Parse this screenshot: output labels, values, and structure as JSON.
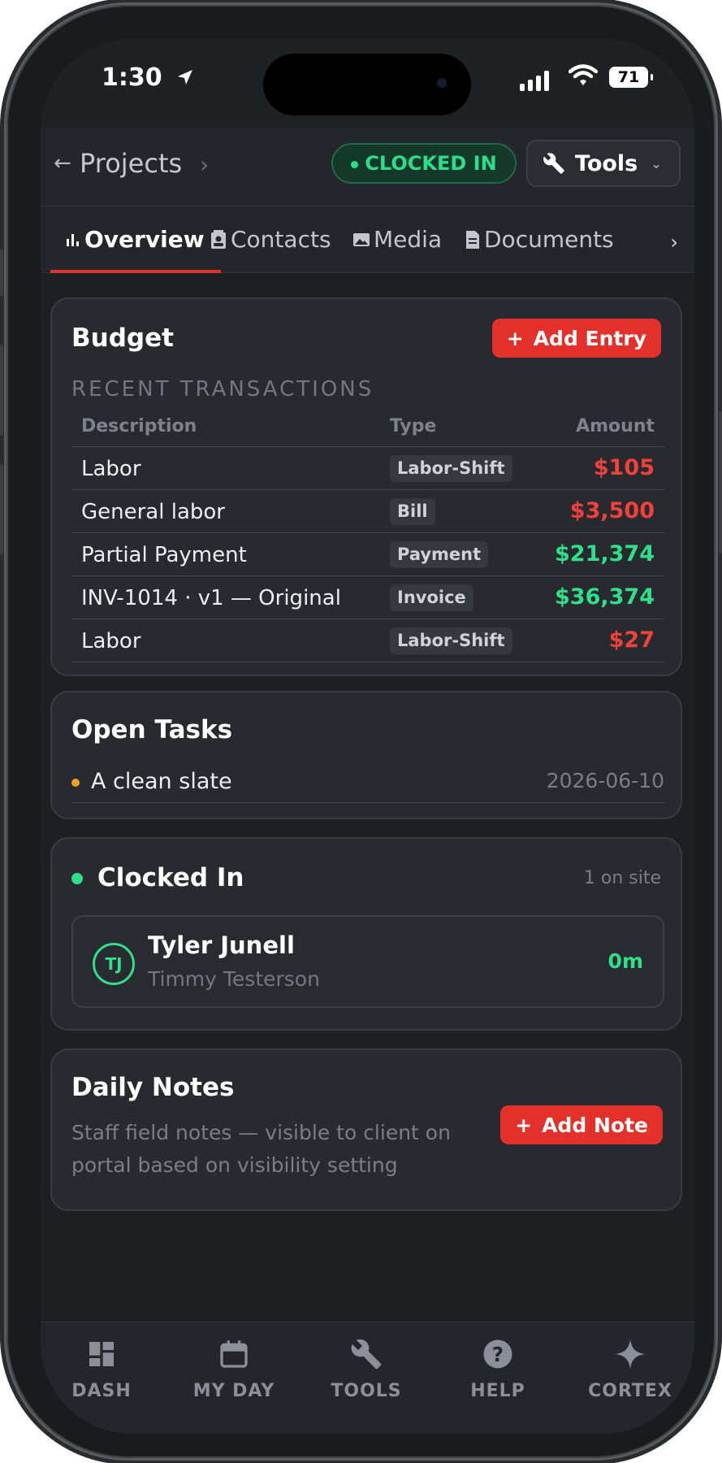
{
  "status_bar": {
    "time": "1:30",
    "battery": "71"
  },
  "header": {
    "back_label": "Projects",
    "clock_status": "CLOCKED IN",
    "tools_label": "Tools"
  },
  "tabs": [
    {
      "label": "Overview"
    },
    {
      "label": "Contacts"
    },
    {
      "label": "Media"
    },
    {
      "label": "Documents"
    }
  ],
  "budget": {
    "title": "Budget",
    "add_label": "Add Entry",
    "section_label": "RECENT TRANSACTIONS",
    "columns": {
      "description": "Description",
      "type": "Type",
      "amount": "Amount"
    },
    "rows": [
      {
        "description": "Labor",
        "type": "Labor-Shift",
        "amount": "$105"
      },
      {
        "description": "General labor",
        "type": "Bill",
        "amount": "$3,500"
      },
      {
        "description": "Partial Payment",
        "type": "Payment",
        "amount": "$21,374"
      },
      {
        "description": "INV-1014 · v1 — Original",
        "type": "Invoice",
        "amount": "$36,374"
      },
      {
        "description": "Labor",
        "type": "Labor-Shift",
        "amount": "$27"
      }
    ],
    "colors": {
      "negative": "#f0413b",
      "positive": "#2ee08a"
    }
  },
  "open_tasks": {
    "title": "Open Tasks",
    "items": [
      {
        "title": "A clean slate",
        "date": "2026-06-10"
      }
    ]
  },
  "clocked_in": {
    "title": "Clocked In",
    "count_label": "1 on site",
    "workers": [
      {
        "initials": "TJ",
        "name": "Tyler Junell",
        "subtitle": "Timmy Testerson",
        "duration": "0m"
      }
    ]
  },
  "daily_notes": {
    "title": "Daily Notes",
    "description": "Staff field notes — visible to client on portal based on visibility setting",
    "add_label": "Add Note"
  },
  "bottom_nav": [
    {
      "label": "DASH",
      "icon": "dashboard-icon"
    },
    {
      "label": "MY DAY",
      "icon": "calendar-icon"
    },
    {
      "label": "TOOLS",
      "icon": "wrench-icon"
    },
    {
      "label": "HELP",
      "icon": "help-icon"
    },
    {
      "label": "CORTEX",
      "icon": "sparkle-icon"
    }
  ],
  "accent_color": "#e3302b"
}
